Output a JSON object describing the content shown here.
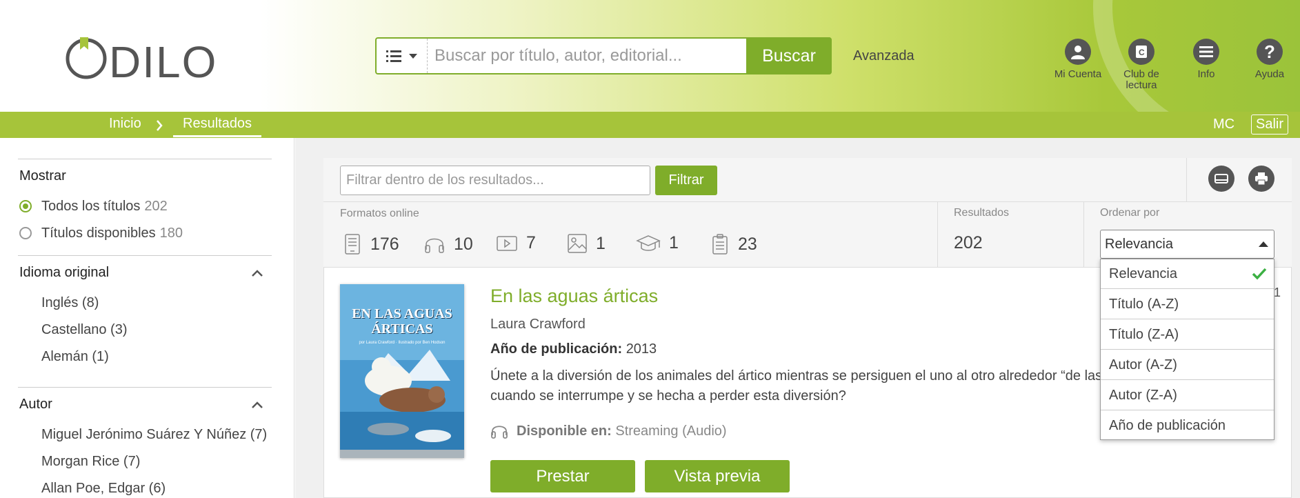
{
  "header": {
    "logo_text": "ODILO",
    "search": {
      "placeholder": "Buscar por título, autor, editorial...",
      "button_label": "Buscar",
      "advanced_label": "Avanzada"
    },
    "icons": [
      {
        "label": "Mi Cuenta",
        "icon": "user-icon"
      },
      {
        "label_line1": "Club de",
        "label_line2": "lectura",
        "icon": "club-icon"
      },
      {
        "label": "Info",
        "icon": "menu-icon"
      },
      {
        "label": "Ayuda",
        "icon": "help-icon"
      }
    ]
  },
  "breadcrumb": {
    "home": "Inicio",
    "current": "Resultados",
    "user_initials": "MC",
    "logout": "Salir"
  },
  "sidebar": {
    "show": {
      "title": "Mostrar",
      "options": [
        {
          "label": "Todos los títulos",
          "count": "202",
          "selected": true
        },
        {
          "label": "Títulos disponibles",
          "count": "180",
          "selected": false
        }
      ]
    },
    "language": {
      "title": "Idioma original",
      "items": [
        "Inglés (8)",
        "Castellano (3)",
        "Alemán (1)"
      ]
    },
    "author": {
      "title": "Autor",
      "items": [
        "Miguel Jerónimo Suárez Y Núñez (7)",
        "Morgan Rice (7)",
        "Allan Poe, Edgar (6)"
      ]
    }
  },
  "toolbar": {
    "filter_placeholder": "Filtrar dentro de los resultados...",
    "filter_button": "Filtrar"
  },
  "stats": {
    "formats_label": "Formatos online",
    "formats": [
      {
        "icon": "ebook-icon",
        "count": "176"
      },
      {
        "icon": "audio-icon",
        "count": "10"
      },
      {
        "icon": "video-icon",
        "count": "7"
      },
      {
        "icon": "image-icon",
        "count": "1"
      },
      {
        "icon": "course-icon",
        "count": "1"
      },
      {
        "icon": "document-icon",
        "count": "23"
      }
    ],
    "results_label": "Resultados",
    "results_count": "202",
    "sort_label": "Ordenar por",
    "sort_selected": "Relevancia",
    "sort_options": [
      "Relevancia",
      "Título (A-Z)",
      "Título (Z-A)",
      "Autor (A-Z)",
      "Autor (Z-A)",
      "Año de publicación"
    ]
  },
  "result": {
    "cover_title_line1": "EN LAS AGUAS",
    "cover_title_line2": "ÁRTICAS",
    "cover_sub": "por Laura Crawford · Ilustrado por Ben Hodson",
    "title": "En las aguas árticas",
    "author": "Laura Crawford",
    "year_label": "Año de publicación:",
    "year": "2013",
    "description": "Únete a la diversión de los animales del ártico mientras se persiguen el uno al otro alrededor “de las aguas árticas” ¿Qué pasa cuando se interrumpe y se hecha a perder esta diversión?",
    "avail_label": "Disponible en:",
    "avail_value": "Streaming (Audio)",
    "buttons": [
      "Prestar",
      "Vista previa"
    ],
    "edge_number": "1"
  },
  "colors": {
    "brand_green": "#7fad2a",
    "bar_green": "#a6c43a"
  }
}
